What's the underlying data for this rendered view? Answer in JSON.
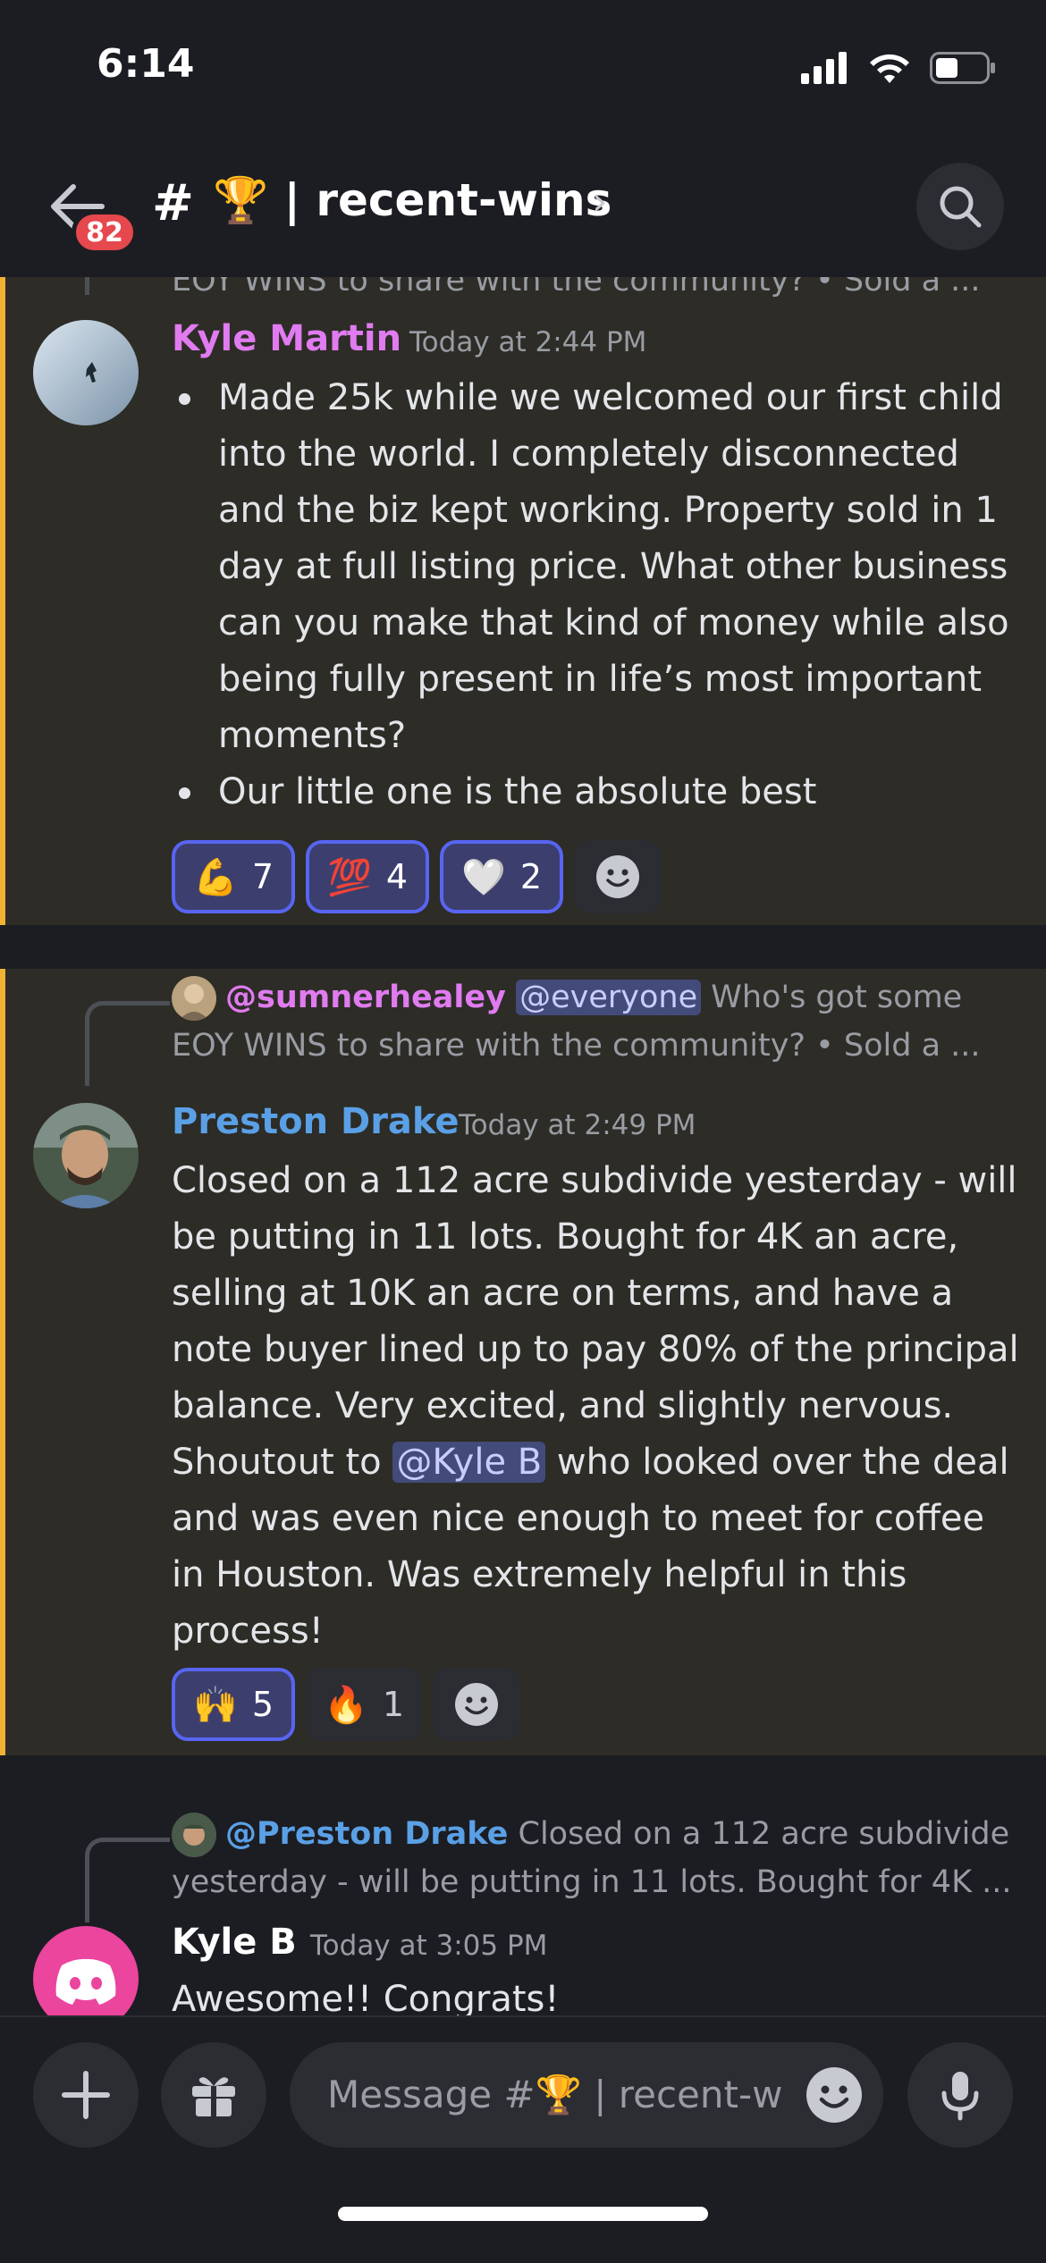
{
  "status": {
    "time": "6:14"
  },
  "header": {
    "unread_badge": "82",
    "channel_hash": "#",
    "channel_name": "🏆 | recent-wins",
    "chevron": "›"
  },
  "messages": {
    "top_cut_reply": "EOY WINS to share with the community? • Sold a ...",
    "m1": {
      "username": "Kyle Martin",
      "timestamp": "Today at 2:44 PM",
      "bullets": [
        "Made 25k while we welcomed our first child into the world. I completely disconnected and the biz kept working. Property sold in 1 day at full listing price. What other business can you make that kind of money while also being fully present in life’s most important moments?",
        "Our little one is the absolute best"
      ],
      "reactions": [
        {
          "emoji": "💪",
          "count": "7"
        },
        {
          "emoji": "💯",
          "count": "4"
        },
        {
          "emoji": "🤍",
          "count": "2"
        }
      ]
    },
    "m2": {
      "reply_user": "@sumnerhealey",
      "reply_mention": "@everyone",
      "reply_text_1": " Who's got some",
      "reply_text_2": "EOY WINS to share with the community? • Sold a ...",
      "username": "Preston Drake",
      "timestamp": "Today at 2:49 PM",
      "text_before": "Closed on a 112 acre subdivide yesterday - will be putting in 11 lots.  Bought for 4K an acre, selling at 10K an acre on terms, and have a note buyer lined up to pay 80% of the principal balance. Very excited, and slightly nervous. Shoutout to ",
      "mention": "@Kyle B",
      "text_after": " who looked over the deal and was even nice enough to meet for coffee in Houston. Was extremely helpful in this process!",
      "reactions": [
        {
          "emoji": "🙌",
          "count": "5"
        },
        {
          "emoji": "🔥",
          "count": "1"
        }
      ]
    },
    "m3": {
      "reply_user": "@Preston Drake",
      "reply_text_1": " Closed on a 112 acre subdivide",
      "reply_text_2": "yesterday - will be putting in 11 lots.  Bought for 4K ...",
      "username": "Kyle B",
      "timestamp": "Today at 3:05 PM",
      "text": "Awesome!! Congrats!"
    }
  },
  "composer": {
    "placeholder": "Message #🏆 | recent-wins"
  },
  "colors": {
    "background": "#1c1d22",
    "highlight": "#2d2c27",
    "highlight_bar": "#f0b232",
    "kyle_martin": "#e07bf0",
    "preston_drake": "#5aa0e6",
    "mention_bg": "#434b7a",
    "badge": "#e5484d",
    "blurple": "#5865f2"
  }
}
